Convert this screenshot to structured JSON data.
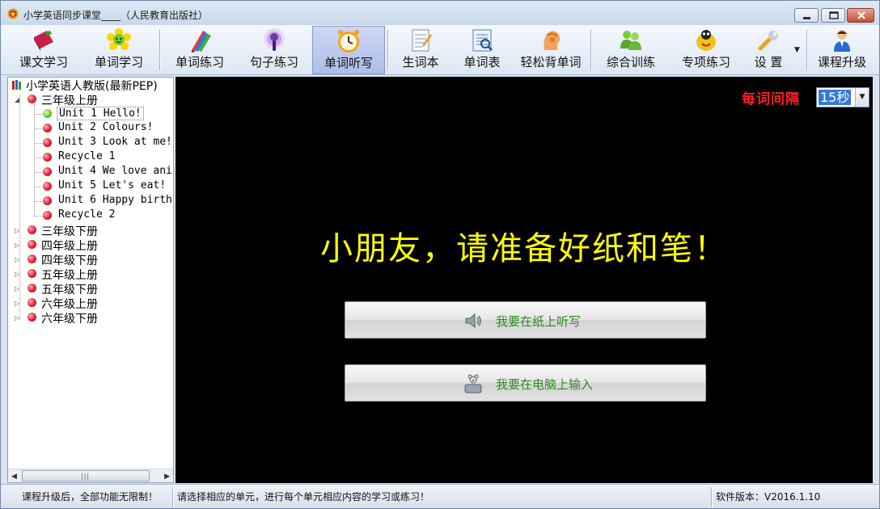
{
  "window": {
    "title": "小学英语同步课堂____（人民教育出版社）"
  },
  "toolbar": {
    "items": [
      {
        "label": "课文学习",
        "icon": "book-icon"
      },
      {
        "label": "单词学习",
        "icon": "flower-icon"
      },
      {
        "label": "单词练习",
        "icon": "pencils-icon"
      },
      {
        "label": "句子练习",
        "icon": "microphone-icon"
      },
      {
        "label": "单词听写",
        "icon": "clock-icon"
      },
      {
        "label": "生词本",
        "icon": "notebook-icon"
      },
      {
        "label": "单词表",
        "icon": "list-icon"
      },
      {
        "label": "轻松背单词",
        "icon": "head-icon"
      },
      {
        "label": "综合训练",
        "icon": "people-icon"
      },
      {
        "label": "专项练习",
        "icon": "ladybug-icon"
      },
      {
        "label": "设 置",
        "icon": "wrench-icon"
      },
      {
        "label": "课程升级",
        "icon": "person-icon"
      }
    ],
    "active_index": 4
  },
  "tree": {
    "root": "小学英语人教版(最新PEP)",
    "grades": [
      {
        "label": "三年级上册",
        "expanded": true
      },
      {
        "label": "三年级下册"
      },
      {
        "label": "四年级上册"
      },
      {
        "label": "四年级下册"
      },
      {
        "label": "五年级上册"
      },
      {
        "label": "五年级下册"
      },
      {
        "label": "六年级上册"
      },
      {
        "label": "六年级下册"
      }
    ],
    "units": [
      {
        "label": "Unit 1 Hello!",
        "selected": true
      },
      {
        "label": "Unit 2 Colours!"
      },
      {
        "label": "Unit 3 Look at me!"
      },
      {
        "label": "Recycle 1"
      },
      {
        "label": "Unit 4 We love ani"
      },
      {
        "label": "Unit 5 Let's eat!"
      },
      {
        "label": "Unit 6 Happy birth"
      },
      {
        "label": "Recycle 2"
      }
    ]
  },
  "main": {
    "interval_label": "每词间隔",
    "interval_value": "15秒",
    "prompt": "小朋友，请准备好纸和笔！",
    "paper_button": "我要在纸上听写",
    "computer_button": "我要在电脑上输入"
  },
  "status": {
    "upgrade_note": "课程升级后，全部功能无限制！",
    "hint": "请选择相应的单元，进行每个单元相应内容的学习或练习！",
    "version": "软件版本：V2016.1.10"
  },
  "colors": {
    "prompt": "#ffff00",
    "interval_label": "#ff1f1f",
    "button_text": "#2c8a1f",
    "main_bg": "#000000"
  }
}
